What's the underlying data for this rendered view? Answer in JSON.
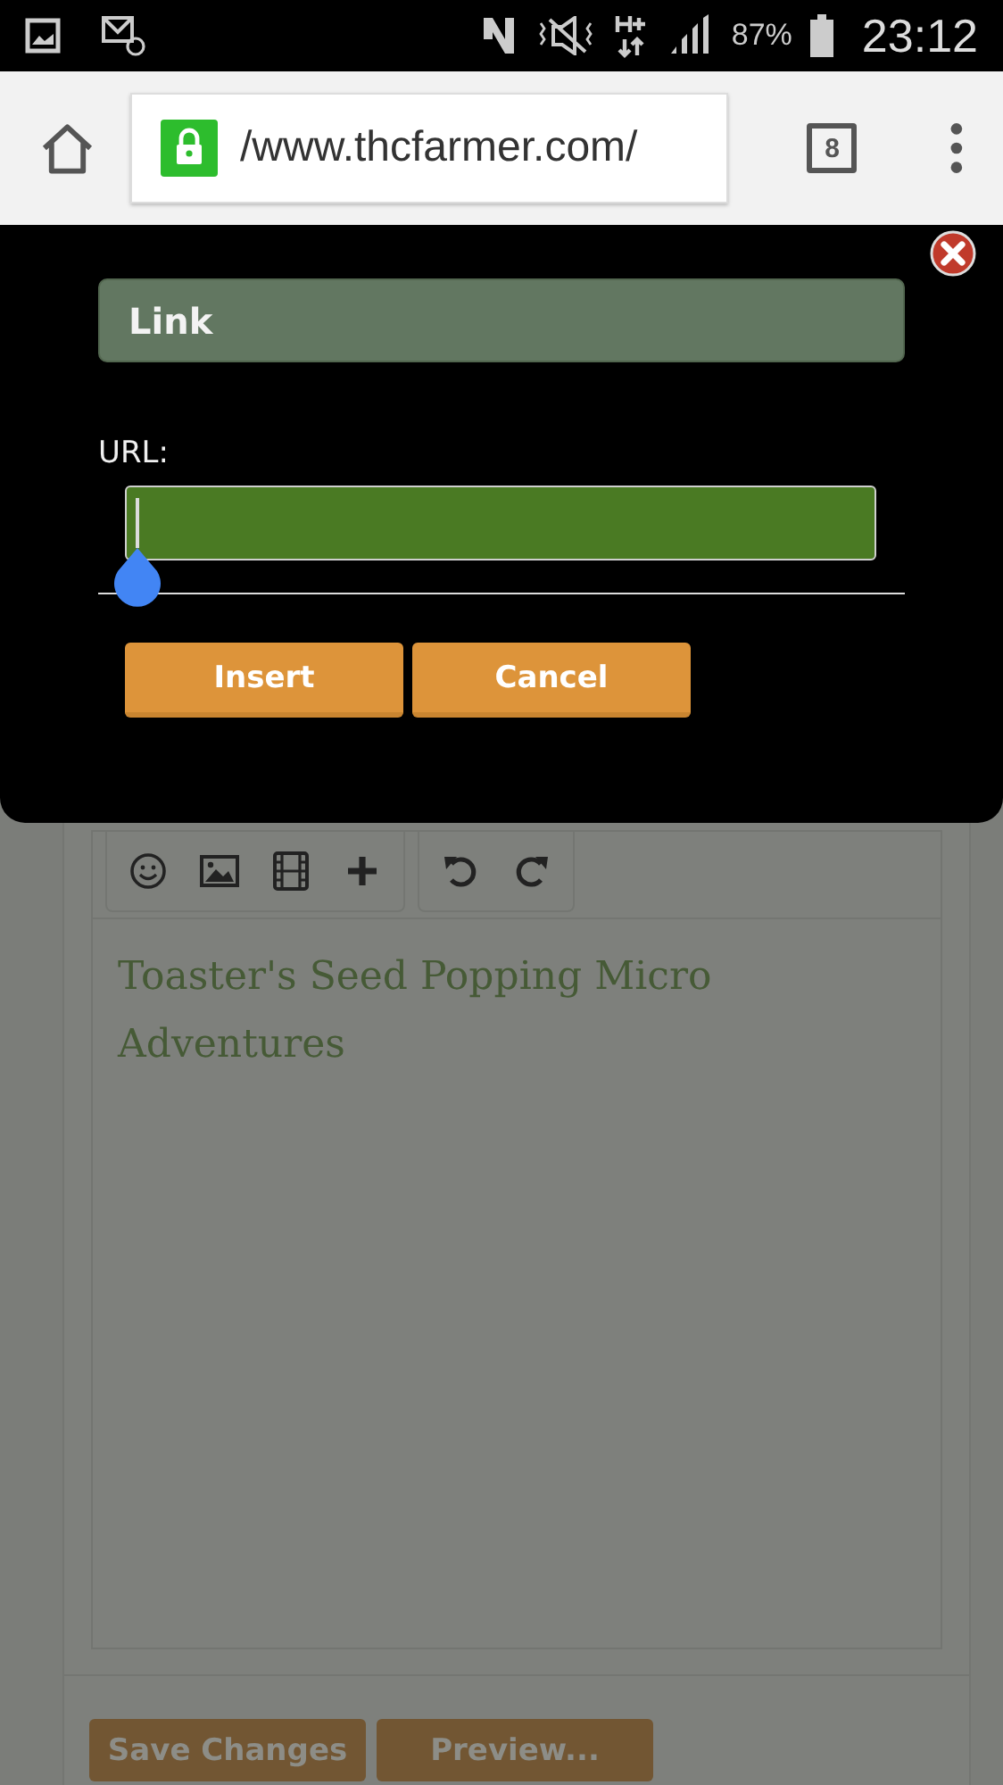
{
  "status_bar": {
    "battery": "87%",
    "time": "23:12"
  },
  "browser": {
    "url": "/www.thcfarmer.com/",
    "tab_count": "8"
  },
  "dialog": {
    "title": "Link",
    "url_label": "URL:",
    "buttons": [
      "Insert",
      "Cancel"
    ]
  },
  "editor": {
    "text": "Toaster's Seed Popping Micro Adventures"
  },
  "buttons": [
    "Save Changes",
    "Preview..."
  ]
}
